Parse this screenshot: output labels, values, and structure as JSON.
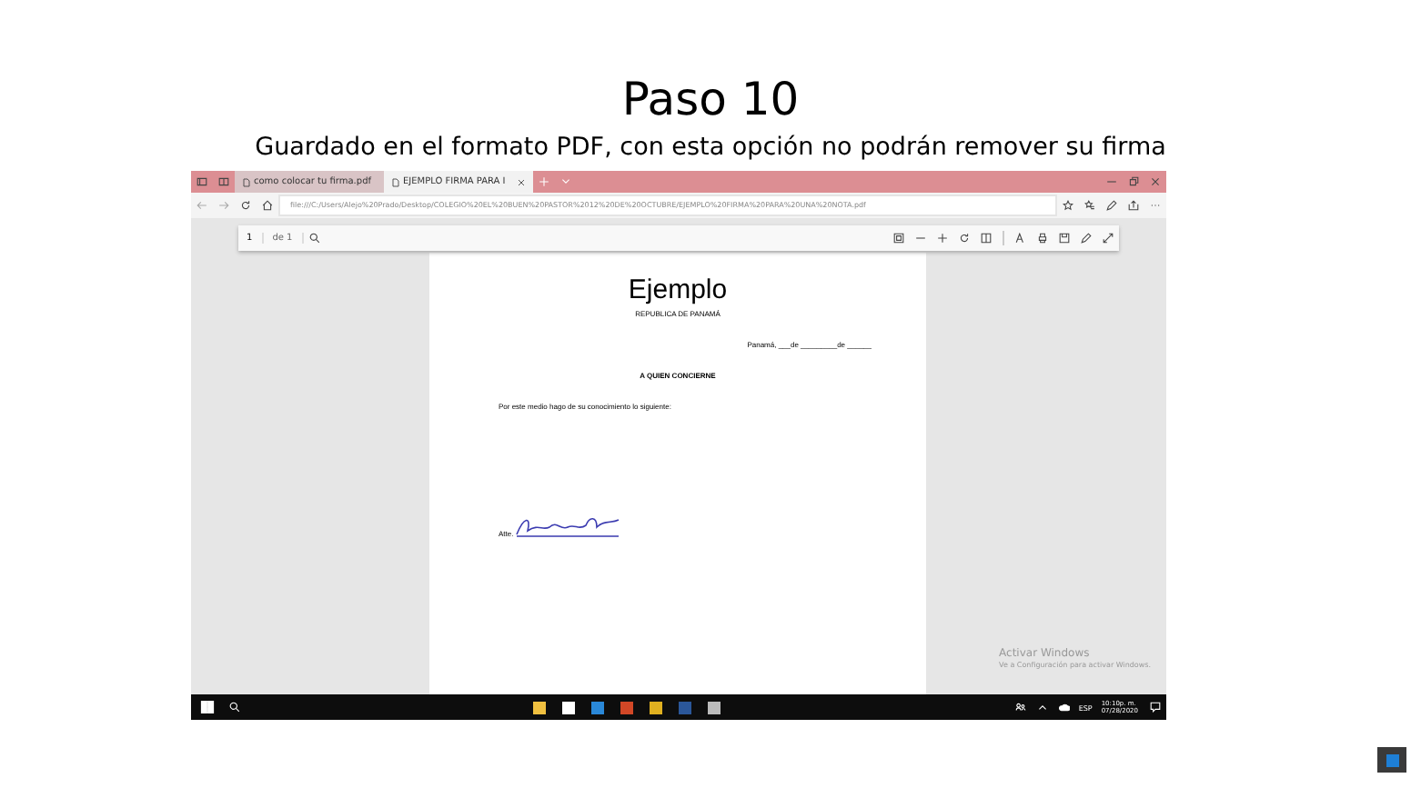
{
  "slide": {
    "title": "Paso 10",
    "subtitle": "Guardado en el formato PDF, con esta opción no podrán remover su firma"
  },
  "tabs": [
    {
      "label": "como colocar tu firma.pdf",
      "selected": false
    },
    {
      "label": "EJEMPLO FIRMA PARA I",
      "selected": true
    }
  ],
  "address": "file:///C:/Users/Alejo%20Prado/Desktop/COLEGIO%20EL%20BUEN%20PASTOR%2012%20DE%20OCTUBRE/EJEMPLO%20FIRMA%20PARA%20UNA%20NOTA.pdf",
  "pdf_toolbar": {
    "page": "1",
    "page_count": "de 1"
  },
  "document": {
    "heading": "Ejemplo",
    "country": "REPUBLICA DE PANAMÁ",
    "date_line": "Panamá, ___de _________de ______",
    "salutation": "A   QUIEN   CONCIERNE",
    "body": "Por este medio hago de su conocimiento lo siguiente:",
    "signature_label": "Atte."
  },
  "activation": {
    "title": "Activar Windows",
    "message": "Ve a Configuración para activar Windows."
  },
  "taskbar": {
    "language": "ESP",
    "time": "10:10p. m.",
    "date": "07/28/2020"
  }
}
